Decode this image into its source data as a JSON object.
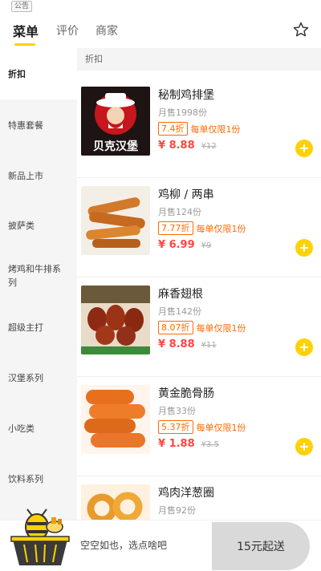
{
  "notice": {
    "badge": "公告"
  },
  "tabs": [
    {
      "label": "菜单"
    },
    {
      "label": "评价"
    },
    {
      "label": "商家"
    }
  ],
  "icons": {
    "favorite": "star-outline-icon",
    "add": "plus-circle-icon",
    "cart": "bee-basket-mascot-icon"
  },
  "colors": {
    "accent": "#ffd100",
    "price": "#ff4640",
    "discount": "#ff6a00"
  },
  "sidebar": {
    "items": [
      {
        "label": "折扣"
      },
      {
        "label": "特惠套餐"
      },
      {
        "label": "新品上市"
      },
      {
        "label": "披萨类"
      },
      {
        "label": "烤鸡和牛排系列"
      },
      {
        "label": "超级主打"
      },
      {
        "label": "汉堡系列"
      },
      {
        "label": "小吃类"
      },
      {
        "label": "饮料系列"
      }
    ]
  },
  "section": {
    "title": "折扣"
  },
  "products": [
    {
      "name": "秘制鸡排堡",
      "sales": "月售1998份",
      "discount": "7.4折",
      "limit": "每单仅限1份",
      "price": "¥ 8.88",
      "orig": "¥12",
      "brand_text": "贝克汉堡"
    },
    {
      "name": "鸡柳 / 两串",
      "sales": "月售124份",
      "discount": "7.77折",
      "limit": "每单仅限1份",
      "price": "¥ 6.99",
      "orig": "¥9"
    },
    {
      "name": "麻香翅根",
      "sales": "月售142份",
      "discount": "8.07折",
      "limit": "每单仅限1份",
      "price": "¥ 8.88",
      "orig": "¥11"
    },
    {
      "name": "黄金脆骨肠",
      "sales": "月售33份",
      "discount": "5.37折",
      "limit": "每单仅限1份",
      "price": "¥ 1.88",
      "orig": "¥3.5"
    },
    {
      "name": "鸡肉洋葱圈",
      "sales": "月售92份"
    }
  ],
  "cart": {
    "empty_text": "空空如也，选点啥吧",
    "min_order": "15元起送"
  }
}
